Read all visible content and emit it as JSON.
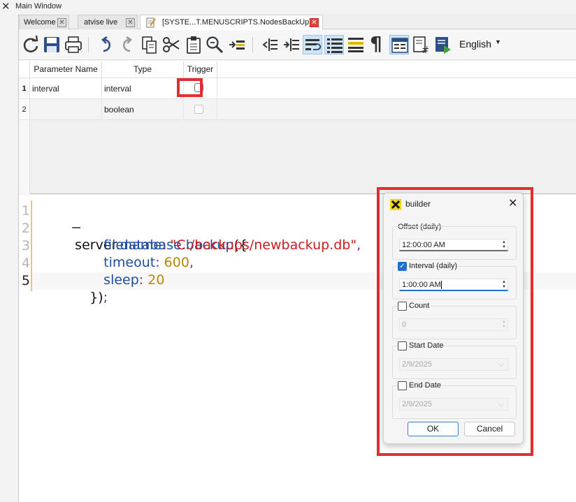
{
  "window": {
    "title": "Main Window",
    "close_glyph": "✕"
  },
  "tabs": [
    {
      "label": "Welcome",
      "close": "✕"
    },
    {
      "label": "atvise live",
      "close": "✕"
    },
    {
      "label": "[SYSTE...T.MENUSCRIPTS.NodesBackUp] *",
      "close": "✕"
    }
  ],
  "toolbar": {
    "icons": [
      "refresh-icon",
      "save-icon",
      "print-icon",
      "undo-icon",
      "redo-icon",
      "copy-icon",
      "cut-icon",
      "paste-icon",
      "find-replace-icon",
      "indent-icon",
      "outdent-less-icon",
      "outdent-more-icon",
      "word-wrap-icon",
      "line-numbers-icon",
      "highlight-lines-icon",
      "pilcrow-icon",
      "split-view-icon",
      "script-hash-icon",
      "run-script-icon"
    ],
    "language": "English",
    "language_caret": "▼",
    "pilcrow": "¶"
  },
  "grid": {
    "headers": [
      "Parameter Name",
      "Type",
      "Trigger"
    ],
    "rows": [
      {
        "num": "1",
        "name": "interval",
        "type": "interval",
        "trigger": false,
        "more": "..."
      },
      {
        "num": "2",
        "name": "",
        "type": "boolean",
        "trigger": false
      }
    ]
  },
  "editor": {
    "line_numbers": [
      "1",
      "2",
      "3",
      "4",
      "5"
    ],
    "fold_marker": "−",
    "line1": {
      "obj": "server",
      "dot1": ".",
      "p1": "database",
      "dot2": ".",
      "p2": "backup",
      "open": "({"
    },
    "line2": {
      "key": "filename",
      "colon": ":",
      "value": "\"C:/backups/newbackup.db\"",
      "comma": ","
    },
    "line3": {
      "key": "timeout",
      "colon": ":",
      "value": "600",
      "comma": ","
    },
    "line4": {
      "key": "sleep",
      "colon": ":",
      "value": "20"
    },
    "line5": {
      "close": "})",
      "semi": ";"
    }
  },
  "dialog": {
    "title": "builder",
    "close": "✕",
    "offset": {
      "label": "Offset (daily)",
      "value": "12:00:00 AM"
    },
    "interval": {
      "label": "Interval (daily)",
      "checked": true,
      "value": "1:00:00 AM"
    },
    "count": {
      "label": "Count",
      "checked": false,
      "value": "0"
    },
    "start_date": {
      "label": "Start Date",
      "checked": false,
      "value": "2/9/2025"
    },
    "end_date": {
      "label": "End Date",
      "checked": false,
      "value": "2/9/2025"
    },
    "ok": "OK",
    "cancel": "Cancel",
    "checkmark": "✓",
    "spin_up": "▲",
    "spin_down": "▼",
    "combo_caret": "⌵"
  },
  "colors": {
    "highlight": "#e02f2f",
    "accent": "#1f6fd1",
    "string": "#cc1b1b",
    "number": "#b8860b",
    "property": "#1f4ea1"
  }
}
